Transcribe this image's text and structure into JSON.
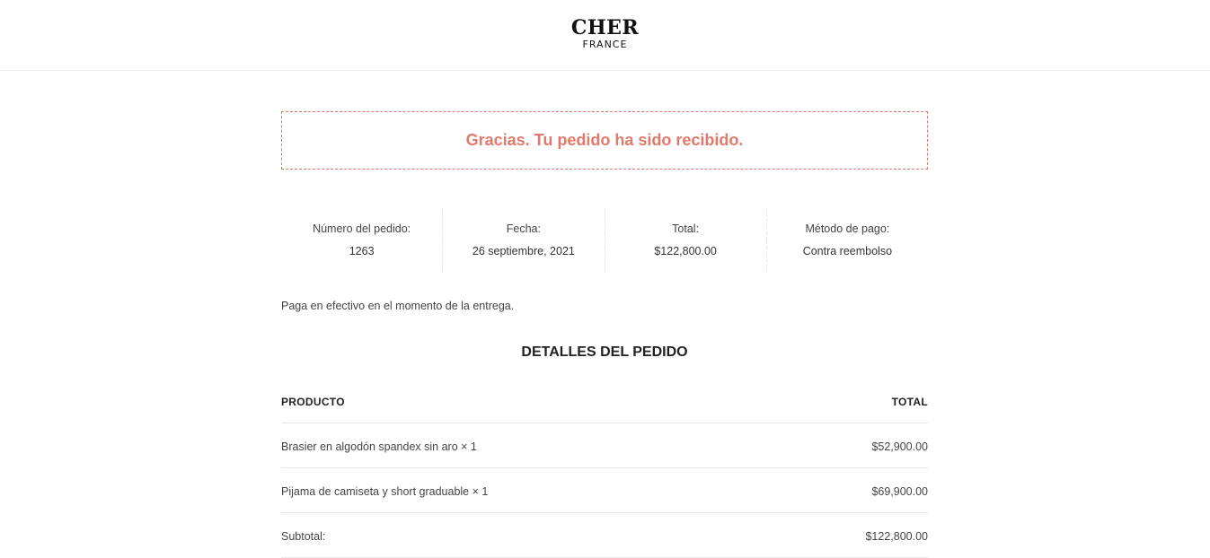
{
  "brand": {
    "name": "CHER",
    "subtitle": "FRANCE"
  },
  "notice": {
    "text": "Gracias. Tu pedido ha sido recibido.",
    "color": "#e07a6c"
  },
  "overview": [
    {
      "label": "Número del pedido:",
      "value": "1263"
    },
    {
      "label": "Fecha:",
      "value": "26 septiembre, 2021"
    },
    {
      "label": "Total:",
      "value": "$122,800.00"
    },
    {
      "label": "Método de pago:",
      "value": "Contra reembolso"
    }
  ],
  "payment_note": "Paga en efectivo en el momento de la entrega.",
  "details": {
    "title": "DETALLES DEL PEDIDO",
    "headers": {
      "product": "PRODUCTO",
      "total": "TOTAL"
    },
    "rows": [
      {
        "product": "Brasier en algodón spandex sin aro × 1",
        "total": "$52,900.00"
      },
      {
        "product": "Pijama de camiseta y short graduable × 1",
        "total": "$69,900.00"
      },
      {
        "product": "Subtotal:",
        "total": "$122,800.00"
      }
    ]
  }
}
